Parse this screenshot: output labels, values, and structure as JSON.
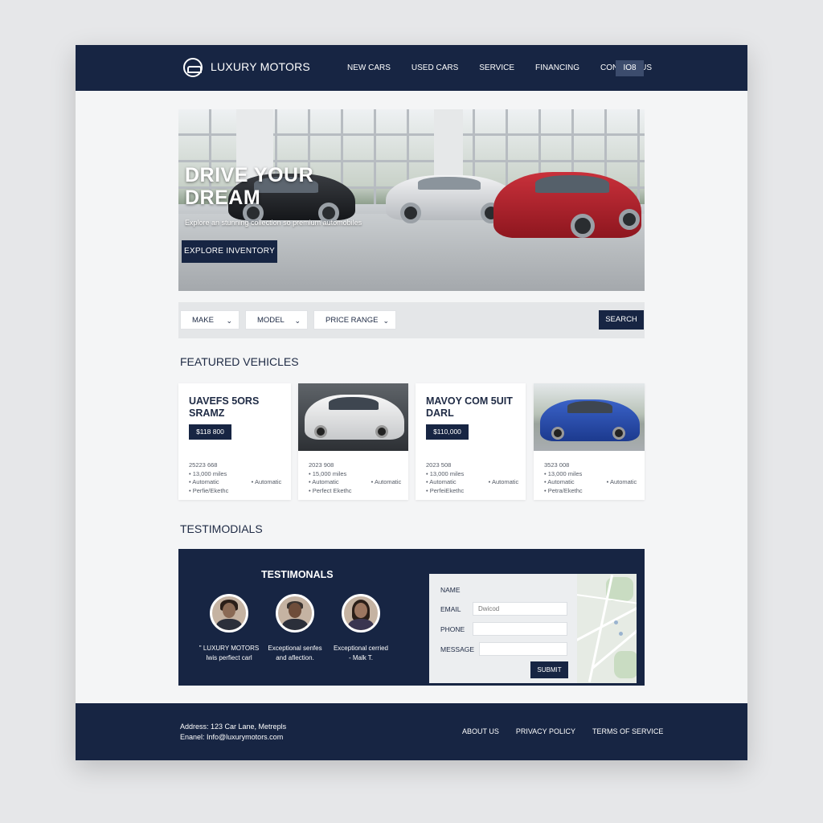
{
  "navbar": {
    "logo_text": "LUXURY MOTORS",
    "links": [
      "NEW CARS",
      "USED CARS",
      "SERVICE",
      "FINANCING",
      "CONTACT US"
    ],
    "badge": "IO8"
  },
  "hero": {
    "title_line1": "DRIVE YOUR",
    "title_line2": "DREAM",
    "subtitle": "Explore an stunning collection so premium automobiles",
    "button": "EXPLORE INVENTORY"
  },
  "search": {
    "make": "MAKE",
    "model": "MODEL",
    "price_range": "PRICE RANGE",
    "button": "SEARCH"
  },
  "featured": {
    "heading": "FEATURED VEHICLES",
    "cards": [
      {
        "title": "UAVEFS 5ORS SRAMZ",
        "price": "$118 800",
        "year": "25223 668",
        "miles": "13,000 miles",
        "trans": "Automatic",
        "trans2": "Automatic",
        "fuel": "Perfie/Ekethc"
      },
      {
        "year": "2023 908",
        "miles": "15,000 miles",
        "trans": "Automatic",
        "trans2": "Automatic",
        "fuel": "Perfect Ekethc"
      },
      {
        "title": "MAVOY COM 5UIT DARL",
        "price": "$110,000",
        "year": "2023 508",
        "miles": "13,000 miles",
        "trans": "Automatic",
        "trans2": "Automatic",
        "fuel": "PerfeiEkethc"
      },
      {
        "year": "3523 008",
        "miles": "13,000 miles",
        "trans": "Automatic",
        "trans2": "Automatic",
        "fuel": "Petra/Ekethc"
      }
    ]
  },
  "testimonials": {
    "section_heading": "TESTIMODIALS",
    "panel_heading": "TESTIMONALS",
    "quotes": [
      {
        "line1": "\" LUXURY MOTORS",
        "line2": "Iwis perfiect carl"
      },
      {
        "line1": "Exceptional senfes",
        "line2": "and aflection."
      },
      {
        "line1": "Exceptional cerried",
        "line2": "- Malk T."
      }
    ]
  },
  "contact": {
    "name_label": "NAME",
    "email_label": "EMAIL",
    "email_placeholder": "Dwicod",
    "phone_label": "PHONE",
    "message_label": "MESSAGE",
    "submit": "SUBMIT"
  },
  "footer": {
    "address": "Address: 123 Car Lane, Metrepls",
    "email": "Enanel: Info@luxurymotors.com",
    "links": [
      "ABOUT US",
      "PRIVACY POLICY",
      "TERMS OF SERVICE"
    ]
  },
  "colors": {
    "navy": "#172543",
    "page_bg": "#f4f5f6"
  }
}
